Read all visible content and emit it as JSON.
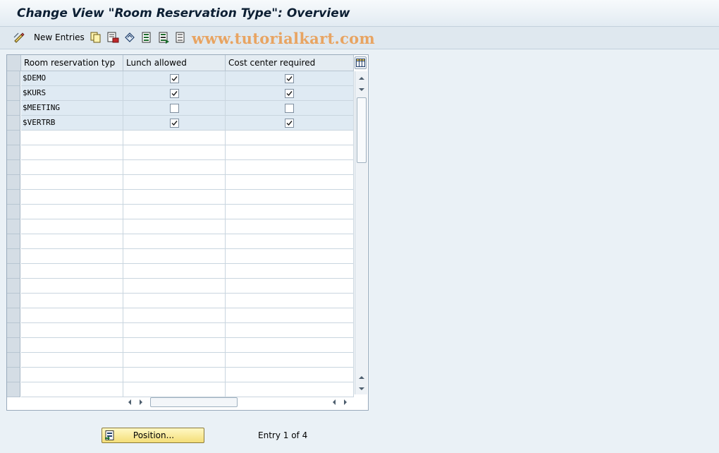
{
  "window": {
    "title": "Change View \"Room Reservation Type\": Overview"
  },
  "toolbar": {
    "new_entries_label": "New Entries",
    "icons": [
      "edit-pencil-icon",
      "copy-icon",
      "delete-icon",
      "undo-icon",
      "select-all-icon",
      "select-block-icon",
      "deselect-all-icon"
    ]
  },
  "watermark": "www.tutorialkart.com",
  "table": {
    "columns": [
      "Room reservation typ",
      "Lunch allowed",
      "Cost center required"
    ],
    "rows": [
      {
        "type": "$DEMO",
        "lunch_allowed": true,
        "cost_center_required": true
      },
      {
        "type": "$KURS",
        "lunch_allowed": true,
        "cost_center_required": true
      },
      {
        "type": "$MEETING",
        "lunch_allowed": false,
        "cost_center_required": false
      },
      {
        "type": "$VERTRB",
        "lunch_allowed": true,
        "cost_center_required": true
      }
    ]
  },
  "footer": {
    "position_button_label": "Position...",
    "entry_info": "Entry 1 of 4"
  }
}
